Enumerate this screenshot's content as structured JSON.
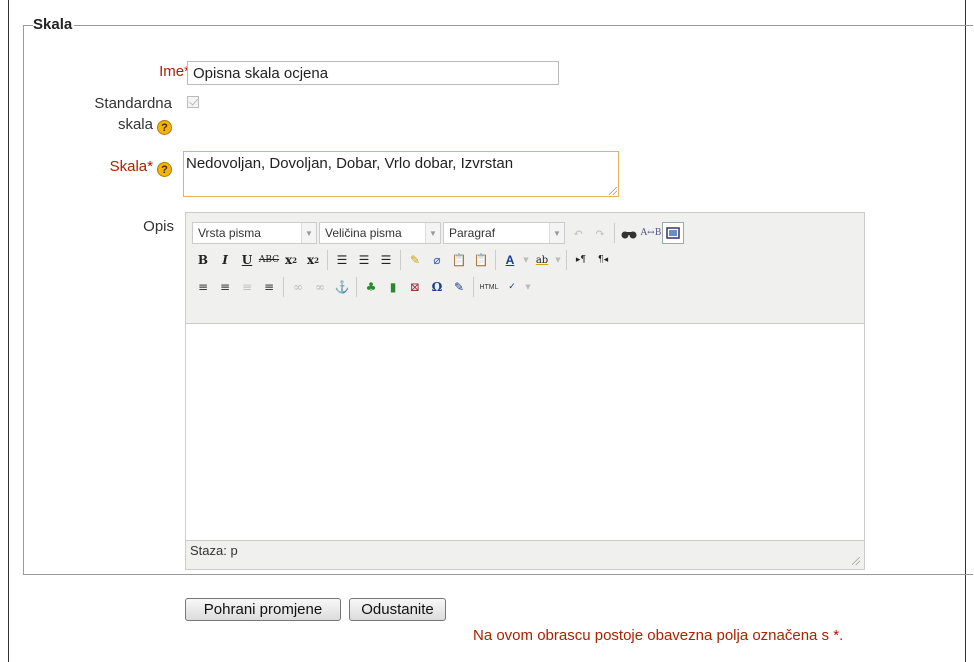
{
  "form": {
    "legend": "Skala",
    "name_label": "Ime",
    "name_value": "Opisna skala ocjena",
    "standard_label_line1": "Standardna",
    "standard_label_line2": "skala",
    "scale_label": "Skala",
    "scale_value": "Nedovoljan, Dovoljan, Dobar, Vrlo dobar, Izvrstan",
    "description_label": "Opis",
    "required_star": "*",
    "help_symbol": "?"
  },
  "editor": {
    "font_select": "Vrsta pisma",
    "size_select": "Veličina pisma",
    "format_select": "Paragraf",
    "status_path": "Staza: p"
  },
  "actions": {
    "save_label": "Pohrani promjene",
    "cancel_label": "Odustanite"
  },
  "footer": {
    "required_note": "Na ovom obrascu postoje obavezna polja označena s ",
    "required_star": "*",
    "required_end": "."
  },
  "colors": {
    "required_label": "#aa2200",
    "help_icon": "#f4b400",
    "focused_border": "#e2b45e"
  }
}
